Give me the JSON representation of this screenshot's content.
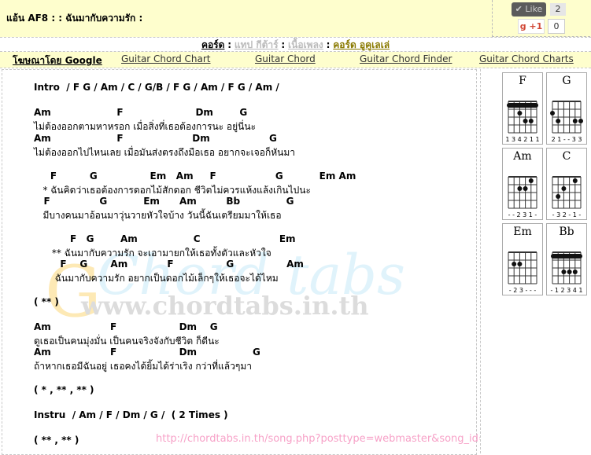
{
  "header": {
    "title": "แอ้น AF8 : : ฉันมากับความรัก :",
    "like_label": "✔ Like",
    "like_count": "2",
    "gplus_label": "+1",
    "gplus_count": "0"
  },
  "tabs": {
    "chord_label": "คอร์ด",
    "sep": ":",
    "tab_dim1": "แทป กีต้าร์",
    "tab_dim2": "เนื้อเพลง",
    "tab_link": "คอร์ด อูคูเลเล่"
  },
  "nav": {
    "items": [
      "โฆษณาโดย Google",
      "Guitar Chord Chart",
      "Guitar Chord",
      "Guitar Chord Finder",
      "Guitar Chord Charts"
    ]
  },
  "watermark": {
    "site": "www.chordtabs.in.th",
    "logo": "Chord tabs",
    "g_mark": "G"
  },
  "lyrics": [
    {
      "text": "Intro  / F G / Am / C / G/B / F G / Am / F G / Am /",
      "chord": true
    },
    {
      "text": "Am                    F                      Dm        G",
      "chord": true
    },
    {
      "text": "ไม่ต้องออกตามหาหรอก เมื่อสิ่งที่เธอต้องการนะ อยู่นี่นะ",
      "chord": false
    },
    {
      "text": "Am                    F                     Dm                  G",
      "chord": true
    },
    {
      "text": "ไม่ต้องออกไปไหนเลย เมื่อมันส่งตรงถึงมือเธอ อยากจะเจอก็หันมา",
      "chord": false
    },
    {
      "text": "     F          G                Em   Am     F                  G           Em Am",
      "chord": true
    },
    {
      "text": "   * ฉันคิดว่าเธอต้องการดอกไม้สักดอก ชีวิตไม่ควรแห้งแล้งเกินไปนะ",
      "chord": false
    },
    {
      "text": "   F               G           Em      Am         Bb              G",
      "chord": true
    },
    {
      "text": "   มีบางคนมาอ้อนมาวุ่นวายหัวใจบ้าง วันนี้ฉันเตรียมมาให้เธอ",
      "chord": false
    },
    {
      "text": "           F   G        Am                 C                        Em",
      "chord": true
    },
    {
      "text": "      ** ฉันมากับความรัก จะเอามายกให้เธอทั้งตัวและหัวใจ",
      "chord": false
    },
    {
      "text": "        F    G       Am            F                G                Am",
      "chord": true
    },
    {
      "text": "       ฉันมากับความรัก อยากเป็นดอกไม้เล็กๆให้เธอจะได้ไหม",
      "chord": false
    },
    {
      "text": "( ** )",
      "chord": true
    },
    {
      "text": "Am                  F                   Dm    G",
      "chord": true
    },
    {
      "text": "ดูเธอเป็นคนมุ่งมั่น เป็นคนจริงจังกับชีวิต ก็ดีนะ",
      "chord": false
    },
    {
      "text": "Am                  F                   Dm                 G",
      "chord": true
    },
    {
      "text": "ถ้าหากเธอมีฉันอยู่ เธอคงได้ยิ้มได้ร่าเริง กว่าที่แล้วๆมา",
      "chord": false
    },
    {
      "text": "( * , ** , ** )",
      "chord": true
    },
    {
      "text": "Instru  / Am / F / Dm / G /  ( 2 Times )",
      "chord": true
    },
    {
      "text": "( ** , ** )",
      "chord": true
    }
  ],
  "url_overlay": "http://chordtabs.in.th/song.php?posttype=webmaster&song_id=3898",
  "chord_diagrams": [
    {
      "name": "F",
      "fingers": "1 3 4 2 1 1"
    },
    {
      "name": "G",
      "fingers": "2 1 - - 3 3"
    },
    {
      "name": "Am",
      "fingers": "- - 2 3 1 -"
    },
    {
      "name": "C",
      "fingers": "- 3 2 - 1 -"
    },
    {
      "name": "Em",
      "fingers": "- 2 3 - - -"
    },
    {
      "name": "Bb",
      "fingers": "- 1 2 3 4 1"
    }
  ],
  "colors": {
    "header_bg": "#fefecd",
    "link": "#8a7a00",
    "url_overlay": "#f7a2c8"
  }
}
